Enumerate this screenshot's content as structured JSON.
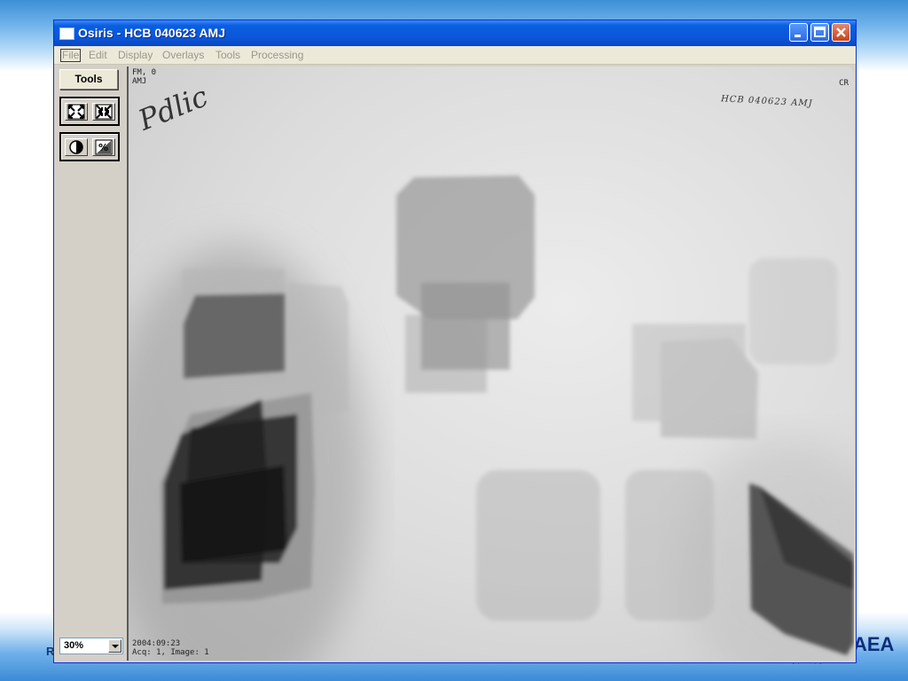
{
  "window": {
    "title": "Osiris - HCB 040623 AMJ",
    "controls": {
      "minimize_icon": "minimize-icon",
      "maximize_icon": "maximize-icon",
      "close_icon": "close-icon"
    }
  },
  "menu": {
    "items": [
      "File",
      "Edit",
      "Display",
      "Overlays",
      "Tools",
      "Processing"
    ]
  },
  "toolpanel": {
    "tools_label": "Tools",
    "zoom_value": "30%"
  },
  "viewer": {
    "overlay_top_left": [
      "FM, 0",
      "AMJ"
    ],
    "overlay_top_right": "CR",
    "handwritten_left": "Pdlic",
    "handwritten_right": "HCB 040623 AMJ",
    "overlay_bottom_left": [
      "2004:09:23",
      "Acq: 1, Image: 1"
    ]
  },
  "slide": {
    "left_footer": "R",
    "logo_text": "AEA"
  },
  "colors": {
    "titlebar": "#0a5fe0",
    "close": "#c4431d",
    "panel": "#d4d0c8",
    "image_bg": "#dcdcdc"
  }
}
